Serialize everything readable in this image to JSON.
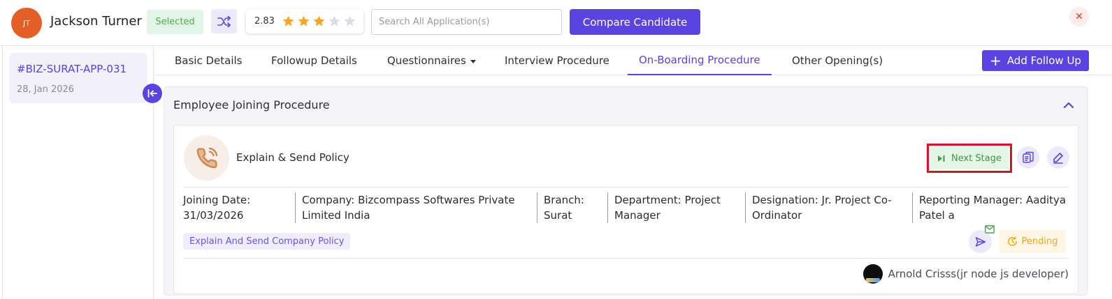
{
  "header": {
    "avatar_initials": "JT",
    "candidate_name": "Jackson Turner",
    "status_badge": "Selected",
    "rating": {
      "value": "2.83",
      "stars_filled": 3,
      "stars_total": 5
    },
    "search_placeholder": "Search All Application(s)",
    "compare_label": "Compare Candidate",
    "close_symbol": "✕"
  },
  "sidebar": {
    "application_id": "#BIZ-SURAT-APP-031",
    "application_date": "28, Jan 2026"
  },
  "tabs": [
    {
      "label": "Basic Details",
      "active": false
    },
    {
      "label": "Followup Details",
      "active": false
    },
    {
      "label": "Questionnaires",
      "active": false,
      "dropdown": true
    },
    {
      "label": "Interview Procedure",
      "active": false
    },
    {
      "label": "On-Boarding Procedure",
      "active": true
    },
    {
      "label": "Other Opening(s)",
      "active": false
    }
  ],
  "add_follow_up": {
    "plus": "+",
    "label": "Add Follow Up"
  },
  "procedure": {
    "title": "Employee Joining Procedure",
    "stage": {
      "title": "Explain & Send Policy",
      "next_stage_label": "Next Stage",
      "info": {
        "joining_date": [
          "Joining Date:",
          "31/03/2026"
        ],
        "company": [
          "Company: Bizcompass Softwares Private",
          "Limited India"
        ],
        "branch": [
          "Branch:",
          "Surat"
        ],
        "department": [
          "Department: Project",
          "Manager"
        ],
        "designation": [
          "Designation: Jr. Project Co-",
          "Ordinator"
        ],
        "reporting_manager": [
          "Reporting Manager: Aaditya",
          "Patel a"
        ]
      },
      "task_chip": "Explain And Send Company Policy",
      "status": "Pending",
      "assignee": "Arnold Crisss(jr node js developer)"
    }
  },
  "colors": {
    "primary": "#5a43e0",
    "success": "#3e9c47",
    "warning": "#f2a618",
    "danger": "#e53935",
    "avatar": "#e35f26"
  }
}
